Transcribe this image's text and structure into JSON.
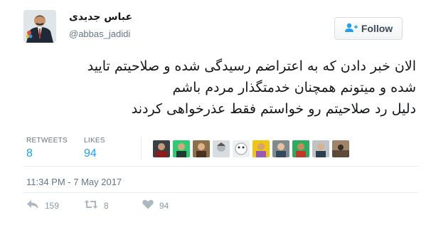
{
  "user": {
    "display_name": "عباس جدیدی",
    "handle": "@abbas_jadidi",
    "avatar_icon": "person-photo-icon"
  },
  "follow_button": {
    "label": "Follow",
    "icon": "add-user-icon"
  },
  "tweet": {
    "lines": [
      "الان خبر دادن که به اعتراضم رسیدگی شده و صلاحیتم تایید",
      "شده و میتونم همچنان خدمتگذار مردم باشم",
      "دلیل رد صلاحیتم رو خواستم فقط عذرخواهی کردند"
    ]
  },
  "stats": {
    "retweets_label": "RETWEETS",
    "retweets_value": "8",
    "likes_label": "LIKES",
    "likes_value": "94"
  },
  "likers": [
    {
      "icon": "liker-avatar-icon"
    },
    {
      "icon": "liker-avatar-icon"
    },
    {
      "icon": "liker-avatar-icon"
    },
    {
      "icon": "liker-avatar-icon"
    },
    {
      "icon": "liker-avatar-icon"
    },
    {
      "icon": "liker-avatar-icon"
    },
    {
      "icon": "liker-avatar-icon"
    },
    {
      "icon": "liker-avatar-icon"
    },
    {
      "icon": "liker-avatar-icon"
    }
  ],
  "timestamp": "11:34 PM - 7 May 2017",
  "actions": {
    "reply_count": "159",
    "retweet_count": "8",
    "like_count": "94"
  },
  "colors": {
    "accent": "#1da1f2",
    "muted": "#657786",
    "action_icon": "#aab8c2"
  }
}
